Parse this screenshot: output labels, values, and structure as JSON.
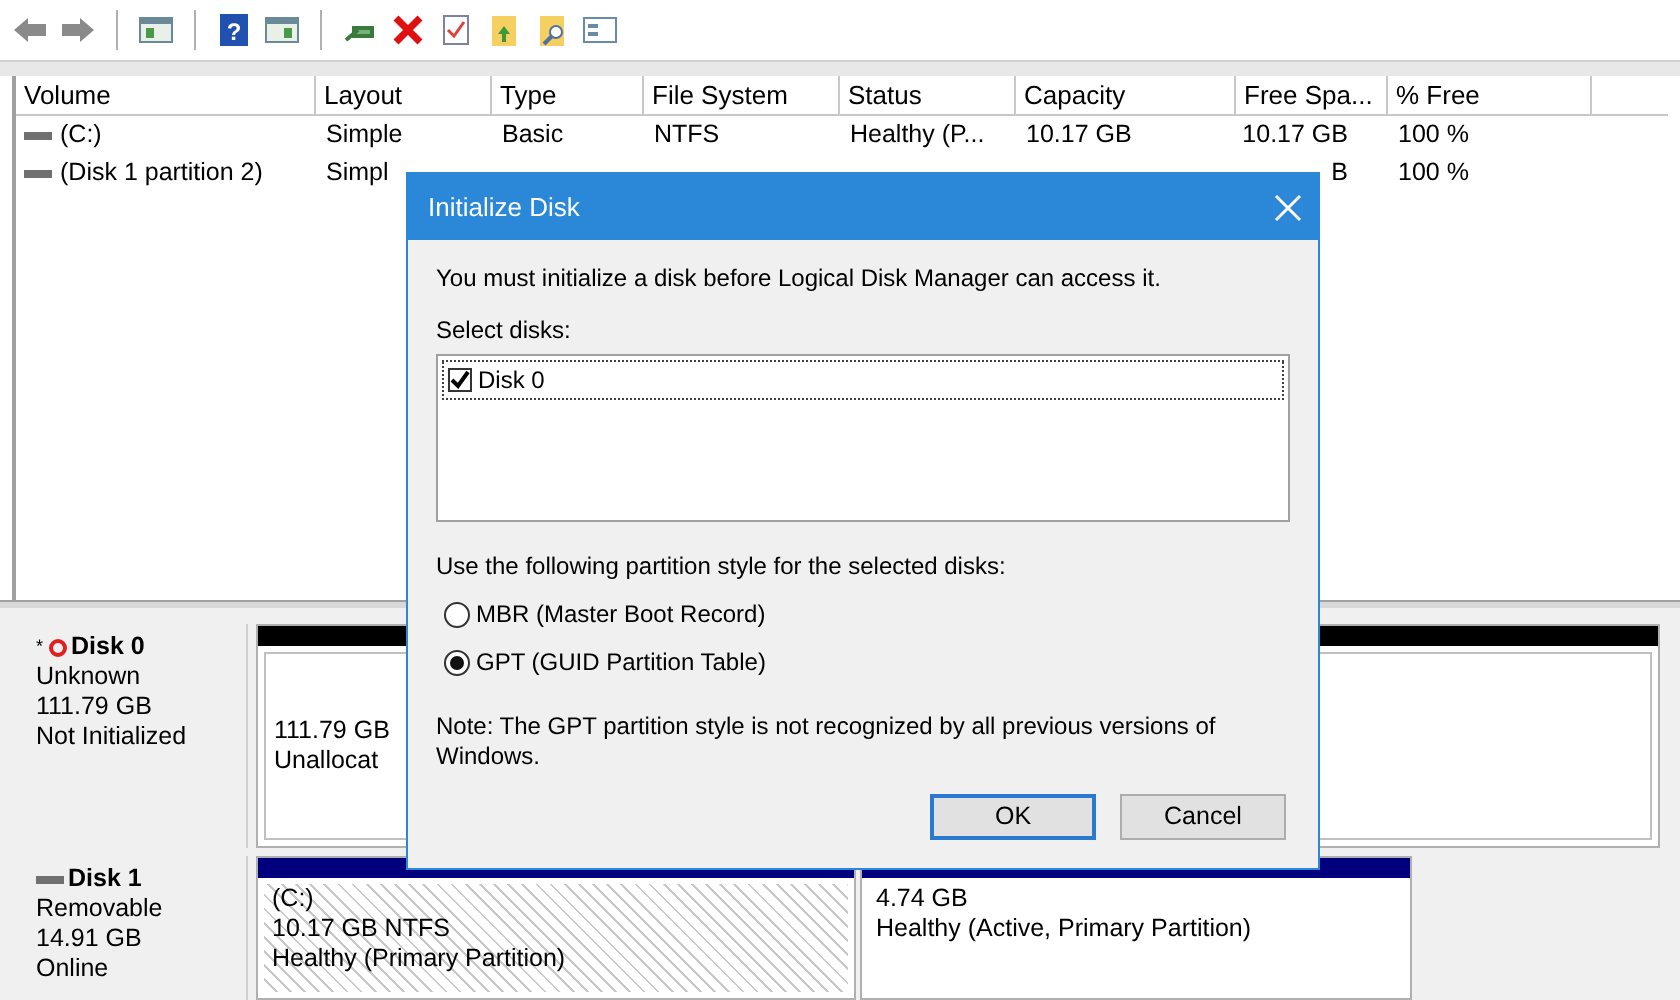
{
  "toolbar": {
    "help_glyph": "?"
  },
  "table": {
    "columns": [
      "Volume",
      "Layout",
      "Type",
      "File System",
      "Status",
      "Capacity",
      "Free Spa...",
      "% Free"
    ],
    "rows": [
      {
        "volume": "(C:)",
        "layout": "Simple",
        "type": "Basic",
        "file_system": "NTFS",
        "status": "Healthy (P...",
        "capacity": "10.17 GB",
        "free_space": "10.17 GB",
        "percent_free": "100 %"
      },
      {
        "volume": "(Disk 1 partition 2)",
        "layout": "Simpl",
        "free_space": "B",
        "percent_free": "100 %"
      }
    ]
  },
  "disks": [
    {
      "kind": "not_initialized",
      "flag": "*",
      "name": "Disk 0",
      "lines": [
        "Unknown",
        "111.79 GB",
        "Not Initialized"
      ],
      "partitions": [
        {
          "color": "#000000",
          "hatched": false,
          "lines": [
            "111.79 GB",
            "Unallocat"
          ]
        }
      ]
    },
    {
      "kind": "online",
      "name": "Disk 1",
      "lines": [
        "Removable",
        "14.91 GB",
        "Online"
      ],
      "partitions": [
        {
          "color": "#00007f",
          "hatched": true,
          "lines": [
            "(C:)",
            "10.17 GB NTFS",
            "Healthy (Primary Partition)"
          ]
        },
        {
          "color": "#00007f",
          "hatched": false,
          "lines": [
            "4.74 GB",
            "Healthy (Active, Primary Partition)"
          ]
        }
      ]
    }
  ],
  "dialog": {
    "title": "Initialize Disk",
    "message": "You must initialize a disk before Logical Disk Manager can access it.",
    "select_label": "Select disks:",
    "disks": [
      {
        "label": "Disk 0",
        "checked": true,
        "selected": true
      }
    ],
    "style_label": "Use the following partition style for the selected disks:",
    "options": [
      {
        "label": "MBR (Master Boot Record)",
        "selected": false
      },
      {
        "label": "GPT (GUID Partition Table)",
        "selected": true
      }
    ],
    "note": "Note: The GPT partition style is not recognized by all previous versions of Windows.",
    "buttons": [
      {
        "label": "OK",
        "default": true
      },
      {
        "label": "Cancel",
        "default": false
      }
    ]
  }
}
